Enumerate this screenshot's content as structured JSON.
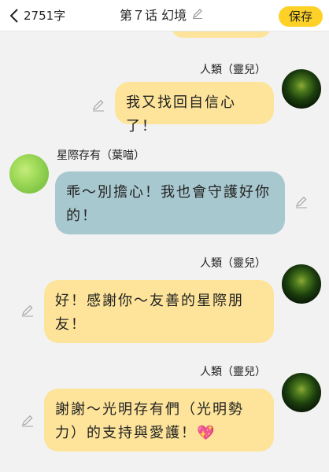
{
  "header": {
    "word_count": "2751字",
    "title": "第７话 幻境",
    "save_label": "保存"
  },
  "messages": [
    {
      "sender": "人類（靈兒）",
      "text": "我又找回自信心了！",
      "side": "right"
    },
    {
      "sender": "星際存有（葉喵）",
      "text": "乖～別擔心！我也會守護好你的！",
      "side": "left"
    },
    {
      "sender": "人類（靈兒）",
      "text": "好！感謝你～友善的星際朋友！",
      "side": "right"
    },
    {
      "sender": "人類（靈兒）",
      "text": "謝謝～光明存有們（光明勢力）的支持與愛護！💖",
      "side": "right"
    }
  ],
  "colors": {
    "accent": "#fdd126",
    "my_bubble": "#fde49a",
    "other_bubble": "#a8c8cf",
    "background": "#f2f2f2"
  },
  "icons": [
    "chevron-left-icon",
    "pencil-icon"
  ]
}
